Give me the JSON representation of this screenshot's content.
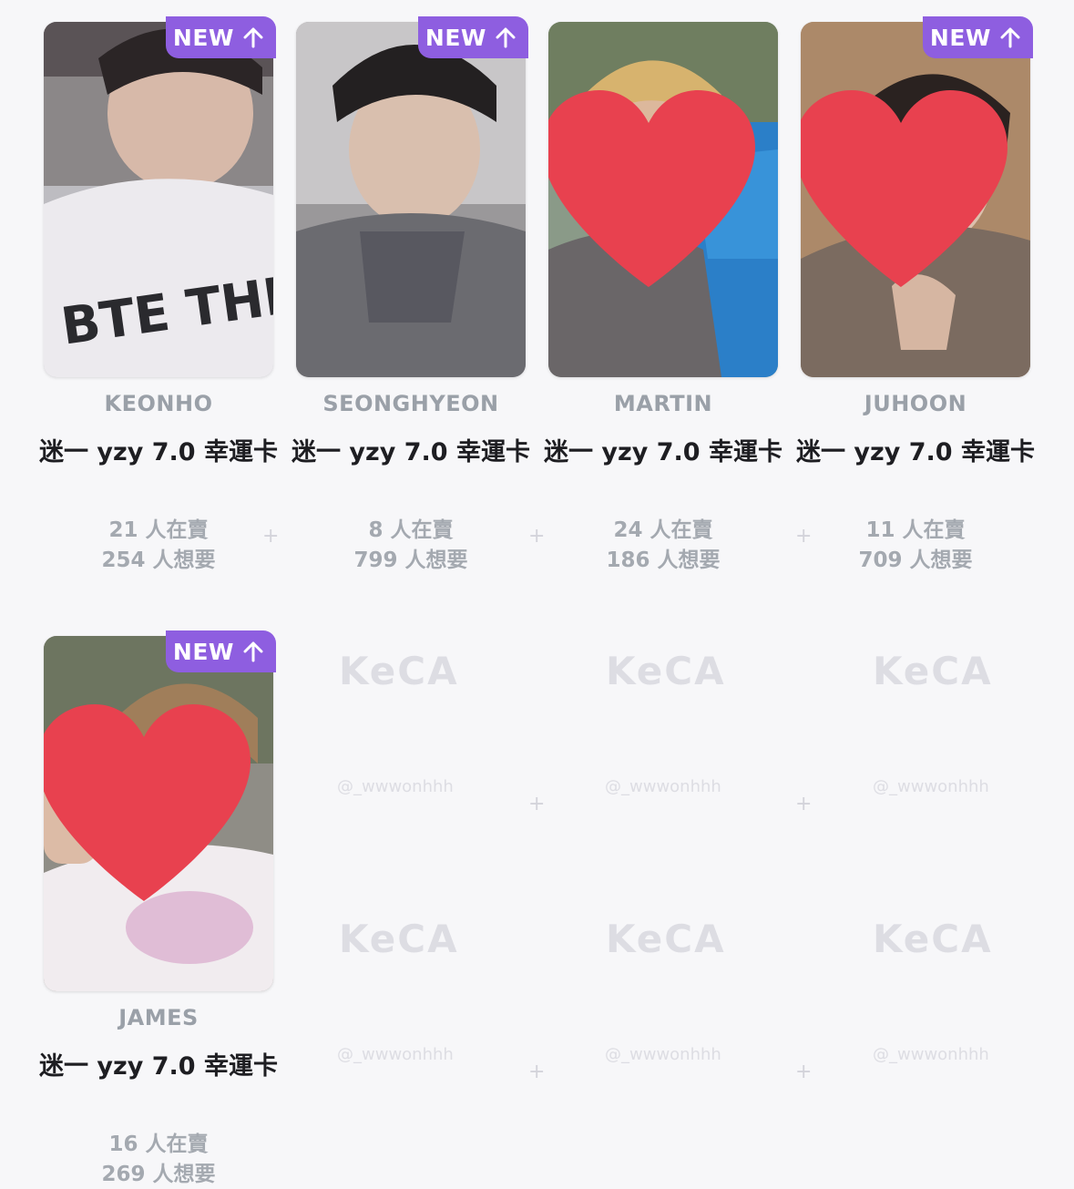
{
  "badge": {
    "label": "NEW"
  },
  "watermark": {
    "brand": "KeCA",
    "handle": "@_wwwonhhh"
  },
  "cards": [
    {
      "member": "KEONHO",
      "title": "迷一 yzy 7.0 幸運卡",
      "selling": "21 人在賣",
      "wanting": "254 人想要",
      "is_new": true,
      "favorited": false
    },
    {
      "member": "SEONGHYEON",
      "title": "迷一 yzy 7.0 幸運卡",
      "selling": "8 人在賣",
      "wanting": "799 人想要",
      "is_new": true,
      "favorited": false
    },
    {
      "member": "MARTIN",
      "title": "迷一 yzy 7.0 幸運卡",
      "selling": "24 人在賣",
      "wanting": "186 人想要",
      "is_new": false,
      "favorited": true
    },
    {
      "member": "JUHOON",
      "title": "迷一 yzy 7.0 幸運卡",
      "selling": "11 人在賣",
      "wanting": "709 人想要",
      "is_new": true,
      "favorited": true
    },
    {
      "member": "JAMES",
      "title": "迷一 yzy 7.0 幸運卡",
      "selling": "16 人在賣",
      "wanting": "269 人想要",
      "is_new": true,
      "favorited": true
    }
  ],
  "colors": {
    "badge": "#8e5ee0",
    "heart": "#e8414f",
    "member_text": "#9aa0a8",
    "title_text": "#1e1e22",
    "stat_text": "#a4a9b0",
    "background": "#f7f7f9"
  },
  "icons": {
    "badge_icon": "arrow-up-icon",
    "favorite_icon": "heart-icon"
  }
}
